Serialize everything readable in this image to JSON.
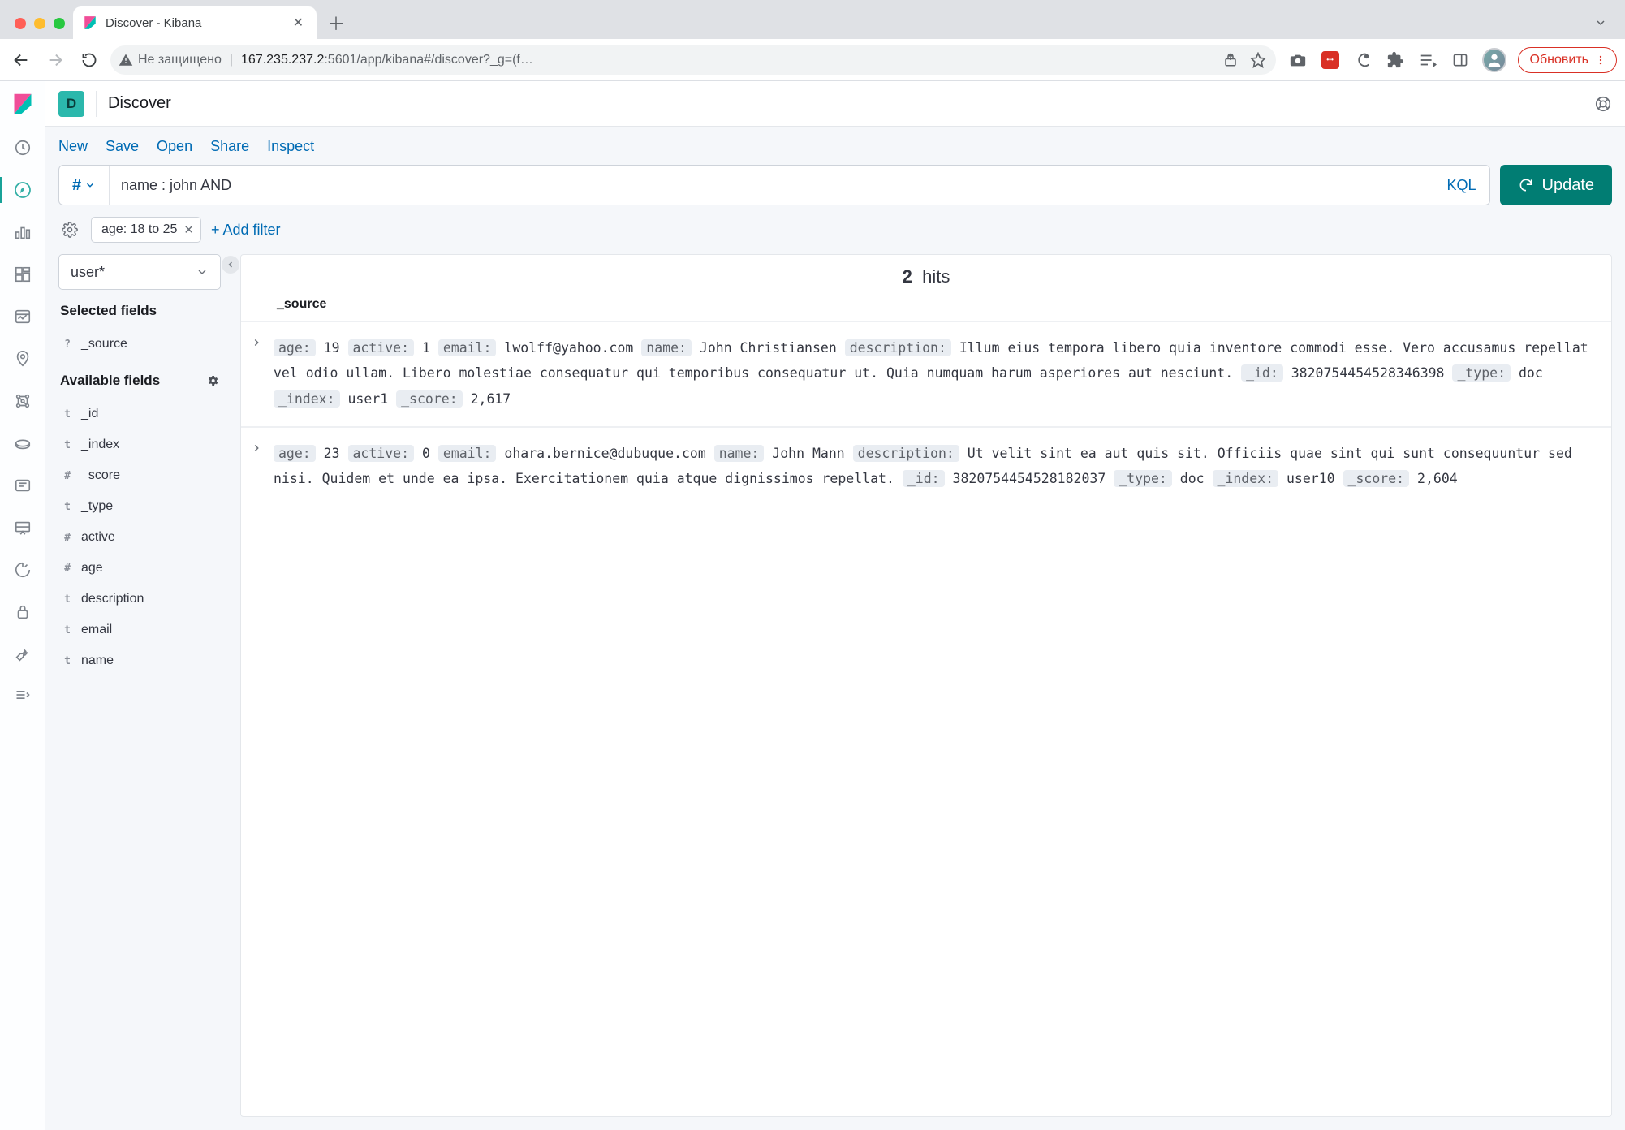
{
  "browser": {
    "tab_title": "Discover - Kibana",
    "security_label": "Не защищено",
    "url_host": "167.235.237.2",
    "url_rest": ":5601/app/kibana#/discover?_g=(f…",
    "update_chip": "Обновить"
  },
  "header": {
    "app_badge": "D",
    "title": "Discover"
  },
  "top_menu": {
    "items": [
      "New",
      "Save",
      "Open",
      "Share",
      "Inspect"
    ]
  },
  "query": {
    "value": "name : john AND",
    "language_label": "KQL",
    "update_label": "Update"
  },
  "filters": {
    "pills": [
      {
        "label": "age: 18 to 25"
      }
    ],
    "add_label": "+ Add filter"
  },
  "sidebar": {
    "index_pattern": "user*",
    "selected_heading": "Selected fields",
    "selected": [
      {
        "type": "?",
        "name": "_source"
      }
    ],
    "available_heading": "Available fields",
    "available": [
      {
        "type": "t",
        "name": "_id"
      },
      {
        "type": "t",
        "name": "_index"
      },
      {
        "type": "#",
        "name": "_score"
      },
      {
        "type": "t",
        "name": "_type"
      },
      {
        "type": "#",
        "name": "active"
      },
      {
        "type": "#",
        "name": "age"
      },
      {
        "type": "t",
        "name": "description"
      },
      {
        "type": "t",
        "name": "email"
      },
      {
        "type": "t",
        "name": "name"
      }
    ]
  },
  "results": {
    "hit_count": "2",
    "hit_label": "hits",
    "column_header": "_source",
    "docs": [
      {
        "fields": [
          {
            "k": "age:",
            "v": "19"
          },
          {
            "k": "active:",
            "v": "1"
          },
          {
            "k": "email:",
            "v": "lwolff@yahoo.com"
          },
          {
            "k": "name:",
            "v": "John Christiansen"
          },
          {
            "k": "description:",
            "v": "Illum eius tempora libero quia inventore commodi esse. Vero accusamus repellat vel odio ullam. Libero molestiae consequatur qui temporibus consequatur ut. Quia numquam harum asperiores aut nesciunt."
          },
          {
            "k": "_id:",
            "v": "3820754454528346398"
          },
          {
            "k": "_type:",
            "v": "doc"
          },
          {
            "k": "_index:",
            "v": "user1"
          },
          {
            "k": "_score:",
            "v": "2,617"
          }
        ]
      },
      {
        "fields": [
          {
            "k": "age:",
            "v": "23"
          },
          {
            "k": "active:",
            "v": "0"
          },
          {
            "k": "email:",
            "v": "ohara.bernice@dubuque.com"
          },
          {
            "k": "name:",
            "v": "John Mann"
          },
          {
            "k": "description:",
            "v": "Ut velit sint ea aut quis sit. Officiis quae sint qui sunt consequuntur sed nisi. Quidem et unde ea ipsa. Exercitationem quia atque dignissimos repellat."
          },
          {
            "k": "_id:",
            "v": "3820754454528182037"
          },
          {
            "k": "_type:",
            "v": "doc"
          },
          {
            "k": "_index:",
            "v": "user10"
          },
          {
            "k": "_score:",
            "v": "2,604"
          }
        ]
      }
    ]
  }
}
